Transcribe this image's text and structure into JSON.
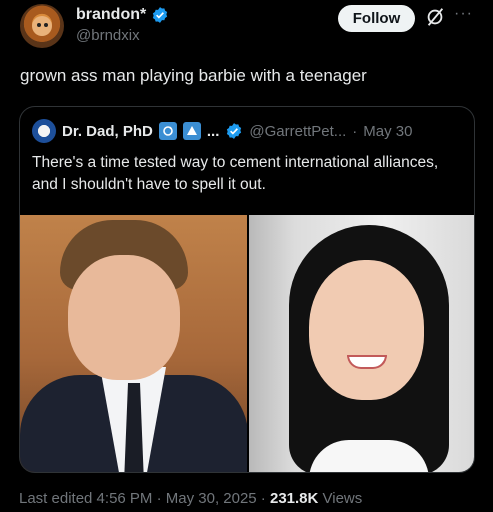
{
  "author": {
    "display_name": "brandon*",
    "handle": "@brndxix"
  },
  "actions": {
    "follow_label": "Follow",
    "more_label": "···"
  },
  "tweet": {
    "text": "grown ass man playing barbie with a teenager"
  },
  "quote": {
    "display_name": "Dr. Dad, PhD",
    "name_suffix": "...",
    "handle": "@GarrettPet...",
    "separator": "·",
    "date": "May 30",
    "body": "There's a time tested way to cement international alliances, and I shouldn't have to spell it out."
  },
  "footer": {
    "edited": "Last edited 4:56 PM · May 30, 2025 · ",
    "views_count": "231.8K",
    "views_label": " Views"
  },
  "colors": {
    "verified": "#1d9bf0",
    "background": "#000000",
    "secondary_text": "#71767b"
  },
  "icons": {
    "verified": "verified-badge-icon",
    "grok": "grok-icon",
    "more": "more-icon"
  }
}
